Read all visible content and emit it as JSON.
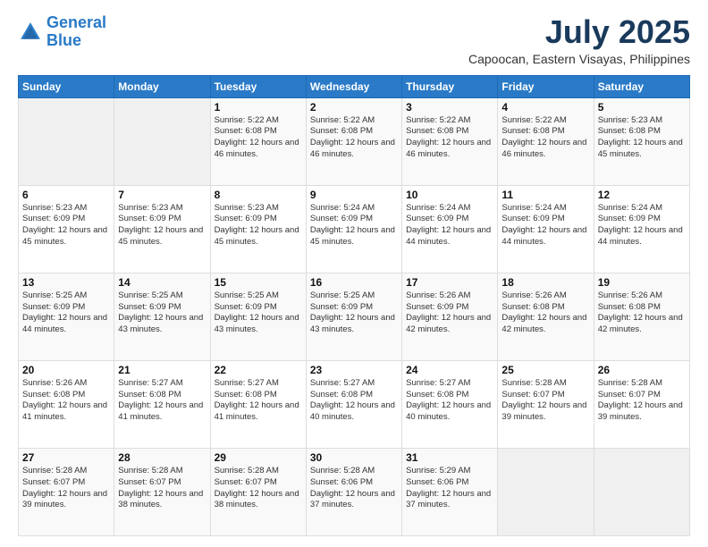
{
  "header": {
    "logo_line1": "General",
    "logo_line2": "Blue",
    "title": "July 2025",
    "subtitle": "Capoocan, Eastern Visayas, Philippines"
  },
  "calendar": {
    "days_of_week": [
      "Sunday",
      "Monday",
      "Tuesday",
      "Wednesday",
      "Thursday",
      "Friday",
      "Saturday"
    ],
    "weeks": [
      [
        {
          "day": "",
          "content": ""
        },
        {
          "day": "",
          "content": ""
        },
        {
          "day": "1",
          "content": "Sunrise: 5:22 AM\nSunset: 6:08 PM\nDaylight: 12 hours and 46 minutes."
        },
        {
          "day": "2",
          "content": "Sunrise: 5:22 AM\nSunset: 6:08 PM\nDaylight: 12 hours and 46 minutes."
        },
        {
          "day": "3",
          "content": "Sunrise: 5:22 AM\nSunset: 6:08 PM\nDaylight: 12 hours and 46 minutes."
        },
        {
          "day": "4",
          "content": "Sunrise: 5:22 AM\nSunset: 6:08 PM\nDaylight: 12 hours and 46 minutes."
        },
        {
          "day": "5",
          "content": "Sunrise: 5:23 AM\nSunset: 6:08 PM\nDaylight: 12 hours and 45 minutes."
        }
      ],
      [
        {
          "day": "6",
          "content": "Sunrise: 5:23 AM\nSunset: 6:09 PM\nDaylight: 12 hours and 45 minutes."
        },
        {
          "day": "7",
          "content": "Sunrise: 5:23 AM\nSunset: 6:09 PM\nDaylight: 12 hours and 45 minutes."
        },
        {
          "day": "8",
          "content": "Sunrise: 5:23 AM\nSunset: 6:09 PM\nDaylight: 12 hours and 45 minutes."
        },
        {
          "day": "9",
          "content": "Sunrise: 5:24 AM\nSunset: 6:09 PM\nDaylight: 12 hours and 45 minutes."
        },
        {
          "day": "10",
          "content": "Sunrise: 5:24 AM\nSunset: 6:09 PM\nDaylight: 12 hours and 44 minutes."
        },
        {
          "day": "11",
          "content": "Sunrise: 5:24 AM\nSunset: 6:09 PM\nDaylight: 12 hours and 44 minutes."
        },
        {
          "day": "12",
          "content": "Sunrise: 5:24 AM\nSunset: 6:09 PM\nDaylight: 12 hours and 44 minutes."
        }
      ],
      [
        {
          "day": "13",
          "content": "Sunrise: 5:25 AM\nSunset: 6:09 PM\nDaylight: 12 hours and 44 minutes."
        },
        {
          "day": "14",
          "content": "Sunrise: 5:25 AM\nSunset: 6:09 PM\nDaylight: 12 hours and 43 minutes."
        },
        {
          "day": "15",
          "content": "Sunrise: 5:25 AM\nSunset: 6:09 PM\nDaylight: 12 hours and 43 minutes."
        },
        {
          "day": "16",
          "content": "Sunrise: 5:25 AM\nSunset: 6:09 PM\nDaylight: 12 hours and 43 minutes."
        },
        {
          "day": "17",
          "content": "Sunrise: 5:26 AM\nSunset: 6:09 PM\nDaylight: 12 hours and 42 minutes."
        },
        {
          "day": "18",
          "content": "Sunrise: 5:26 AM\nSunset: 6:08 PM\nDaylight: 12 hours and 42 minutes."
        },
        {
          "day": "19",
          "content": "Sunrise: 5:26 AM\nSunset: 6:08 PM\nDaylight: 12 hours and 42 minutes."
        }
      ],
      [
        {
          "day": "20",
          "content": "Sunrise: 5:26 AM\nSunset: 6:08 PM\nDaylight: 12 hours and 41 minutes."
        },
        {
          "day": "21",
          "content": "Sunrise: 5:27 AM\nSunset: 6:08 PM\nDaylight: 12 hours and 41 minutes."
        },
        {
          "day": "22",
          "content": "Sunrise: 5:27 AM\nSunset: 6:08 PM\nDaylight: 12 hours and 41 minutes."
        },
        {
          "day": "23",
          "content": "Sunrise: 5:27 AM\nSunset: 6:08 PM\nDaylight: 12 hours and 40 minutes."
        },
        {
          "day": "24",
          "content": "Sunrise: 5:27 AM\nSunset: 6:08 PM\nDaylight: 12 hours and 40 minutes."
        },
        {
          "day": "25",
          "content": "Sunrise: 5:28 AM\nSunset: 6:07 PM\nDaylight: 12 hours and 39 minutes."
        },
        {
          "day": "26",
          "content": "Sunrise: 5:28 AM\nSunset: 6:07 PM\nDaylight: 12 hours and 39 minutes."
        }
      ],
      [
        {
          "day": "27",
          "content": "Sunrise: 5:28 AM\nSunset: 6:07 PM\nDaylight: 12 hours and 39 minutes."
        },
        {
          "day": "28",
          "content": "Sunrise: 5:28 AM\nSunset: 6:07 PM\nDaylight: 12 hours and 38 minutes."
        },
        {
          "day": "29",
          "content": "Sunrise: 5:28 AM\nSunset: 6:07 PM\nDaylight: 12 hours and 38 minutes."
        },
        {
          "day": "30",
          "content": "Sunrise: 5:28 AM\nSunset: 6:06 PM\nDaylight: 12 hours and 37 minutes."
        },
        {
          "day": "31",
          "content": "Sunrise: 5:29 AM\nSunset: 6:06 PM\nDaylight: 12 hours and 37 minutes."
        },
        {
          "day": "",
          "content": ""
        },
        {
          "day": "",
          "content": ""
        }
      ]
    ]
  }
}
